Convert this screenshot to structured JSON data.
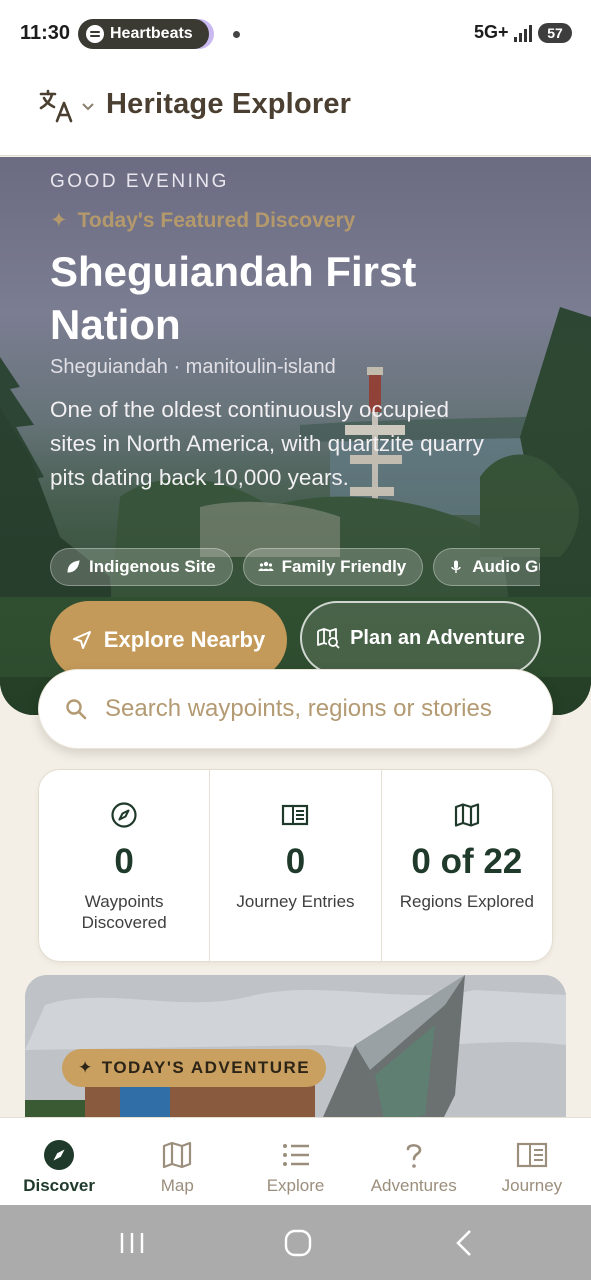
{
  "status_bar": {
    "time": "11:30",
    "media_pill": "Heartbeats",
    "network": "5G+",
    "battery": "57"
  },
  "header": {
    "title": "Heritage Explorer",
    "language_icon": "translate-icon"
  },
  "hero": {
    "greeting": "GOOD EVENING",
    "featured_label": "Today's Featured Discovery",
    "title": "Sheguiandah First Nation",
    "location": "Sheguiandah · manitoulin-island",
    "description": "One of the oldest continuously occupied sites in North America, with quartzite quarry pits dating back 10,000 years.",
    "tags": [
      {
        "label": "Indigenous Site",
        "icon": "leaf-icon"
      },
      {
        "label": "Family Friendly",
        "icon": "people-icon"
      },
      {
        "label": "Audio Guide",
        "icon": "microphone-icon"
      }
    ],
    "explore_button": "Explore Nearby",
    "plan_button": "Plan an Adventure"
  },
  "search": {
    "placeholder": "Search waypoints, regions or stories"
  },
  "stats": [
    {
      "value": "0",
      "label": "Waypoints Discovered",
      "icon": "compass-icon"
    },
    {
      "value": "0",
      "label": "Journey Entries",
      "icon": "journal-icon"
    },
    {
      "value": "0 of 22",
      "label": "Regions Explored",
      "icon": "map-icon"
    }
  ],
  "adventure": {
    "badge": "TODAY'S ADVENTURE"
  },
  "bottom_nav": [
    {
      "label": "Discover",
      "icon": "compass-icon",
      "active": true
    },
    {
      "label": "Map",
      "icon": "map-icon",
      "active": false
    },
    {
      "label": "Explore",
      "icon": "list-icon",
      "active": false
    },
    {
      "label": "Adventures",
      "icon": "question-icon",
      "active": false
    },
    {
      "label": "Journey",
      "icon": "journal-icon",
      "active": false
    }
  ],
  "colors": {
    "accent": "#c49a5a",
    "primary": "#1f3a2b",
    "background": "#f4efe6",
    "nav_inactive": "#9b8e7c"
  }
}
